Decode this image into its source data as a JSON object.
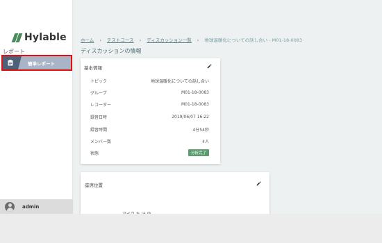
{
  "brand": {
    "name": "Hylable",
    "color": "#4a8a5c"
  },
  "sidebar": {
    "section_label": "レポート",
    "items": [
      {
        "label": "簡単レポート",
        "icon": "clipboard-icon",
        "active": true
      }
    ],
    "user": {
      "name": "admin",
      "icon": "user-avatar-icon"
    }
  },
  "breadcrumb": {
    "items": [
      "ホーム",
      "テストコース",
      "ディスカッション一覧"
    ],
    "current": "地球温暖化についての話し合い - M01-18-0083"
  },
  "page_title": "ディスカッションの情報",
  "basic_info": {
    "title": "基本情報",
    "rows": [
      {
        "label": "トピック",
        "value": "地球温暖化についての話し合い"
      },
      {
        "label": "グループ",
        "value": "M01-18-0083"
      },
      {
        "label": "レコーダー",
        "value": "M01-18-0083"
      },
      {
        "label": "録音日時",
        "value": "2019/06/07 16:22"
      },
      {
        "label": "録音時間",
        "value": "4分54秒"
      },
      {
        "label": "メンバー数",
        "value": "4人"
      },
      {
        "label": "状態",
        "value": "分析完了"
      }
    ]
  },
  "seating": {
    "title": "座席位置",
    "partial_text": "マイク  ち  ほ  ゆ"
  },
  "colors": {
    "highlight": "#e01010",
    "status_ok": "#5c9c6e",
    "nav_active": "#a9b4c6"
  }
}
